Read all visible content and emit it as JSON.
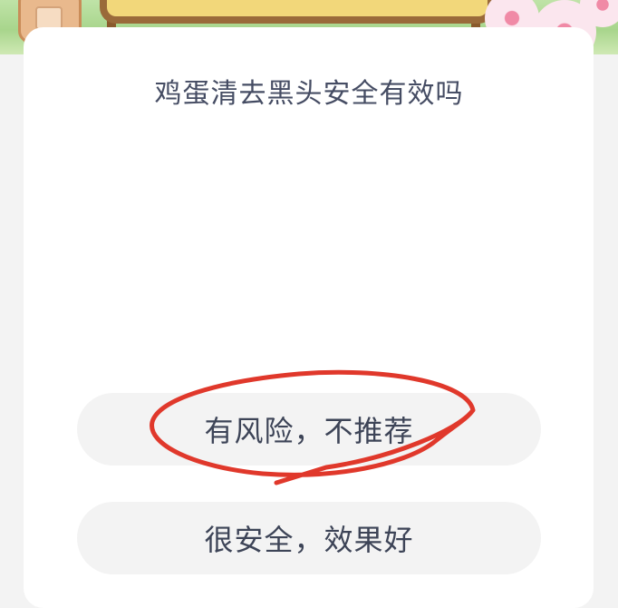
{
  "question": {
    "text": "鸡蛋清去黑头安全有效吗"
  },
  "options": [
    {
      "label": "有风险，不推荐"
    },
    {
      "label": "很安全，效果好"
    }
  ],
  "annotation": {
    "color": "#e0382b",
    "circled_option": 0
  }
}
